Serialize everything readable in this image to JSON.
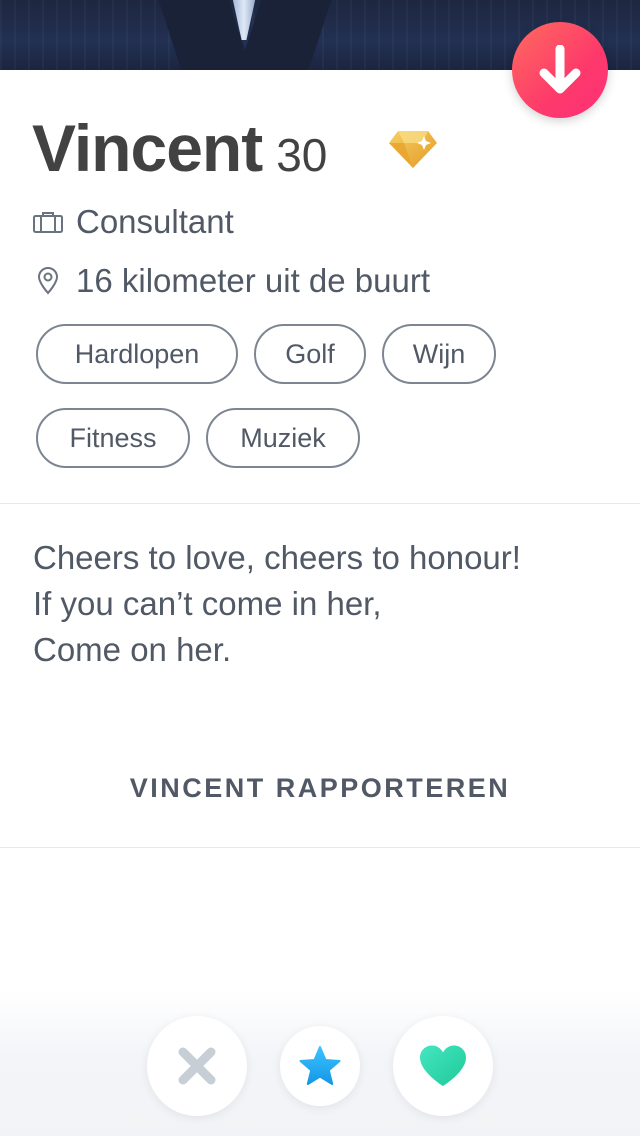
{
  "profile": {
    "name": "Vincent",
    "age": "30",
    "job": "Consultant",
    "distance": "16 kilometer uit de buurt",
    "interests": [
      "Hardlopen",
      "Golf",
      "Wijn",
      "Fitness",
      "Muziek"
    ],
    "bio_lines": [
      "Cheers to love, cheers to honour!",
      "If you can’t come in her,",
      "Come on her."
    ],
    "report_label": "VINCENT RAPPORTEREN"
  },
  "icons": {
    "collapse": "arrow-down-icon",
    "premium": "diamond-icon",
    "job": "briefcase-icon",
    "distance": "location-pin-icon",
    "nope": "close-icon",
    "superlike": "star-icon",
    "like": "heart-icon"
  },
  "colors": {
    "accent_gradient_start": "#ff6b5e",
    "accent_gradient_end": "#fe2f78",
    "nope": "#c8ced6",
    "superlike": "#1fa9f2",
    "like": "#2fdcb0",
    "gem": "#f0b23a"
  }
}
